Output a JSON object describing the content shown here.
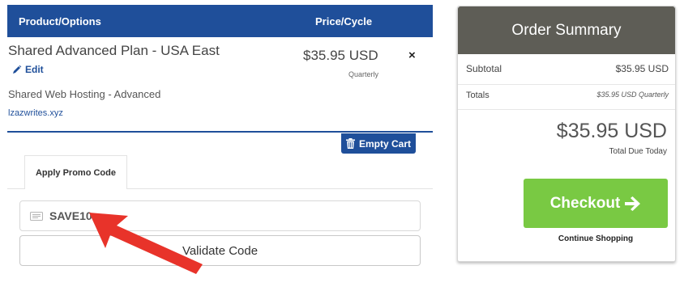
{
  "cart": {
    "header": {
      "product_col": "Product/Options",
      "price_col": "Price/Cycle"
    },
    "item": {
      "name": "Shared Advanced Plan - USA East",
      "edit_label": "Edit",
      "description": "Shared Web Hosting - Advanced",
      "domain": "lzazwrites.xyz",
      "price": "$35.95 USD",
      "cycle": "Quarterly",
      "remove_icon": "×"
    },
    "empty_cart_label": "Empty Cart"
  },
  "promo": {
    "tab_label": "Apply Promo Code",
    "code_value": "SAVE10",
    "validate_label": "Validate Code"
  },
  "summary": {
    "title": "Order Summary",
    "subtotal_label": "Subtotal",
    "subtotal_value": "$35.95 USD",
    "totals_label": "Totals",
    "totals_value": "$35.95 USD Quarterly",
    "total_amount": "$35.95 USD",
    "total_due_label": "Total Due Today",
    "checkout_label": "Checkout",
    "continue_label": "Continue Shopping"
  },
  "colors": {
    "header_blue": "#1f4f9a",
    "summary_header": "#5e5d56",
    "checkout_green": "#79c943",
    "arrow_red": "#e8332a"
  }
}
